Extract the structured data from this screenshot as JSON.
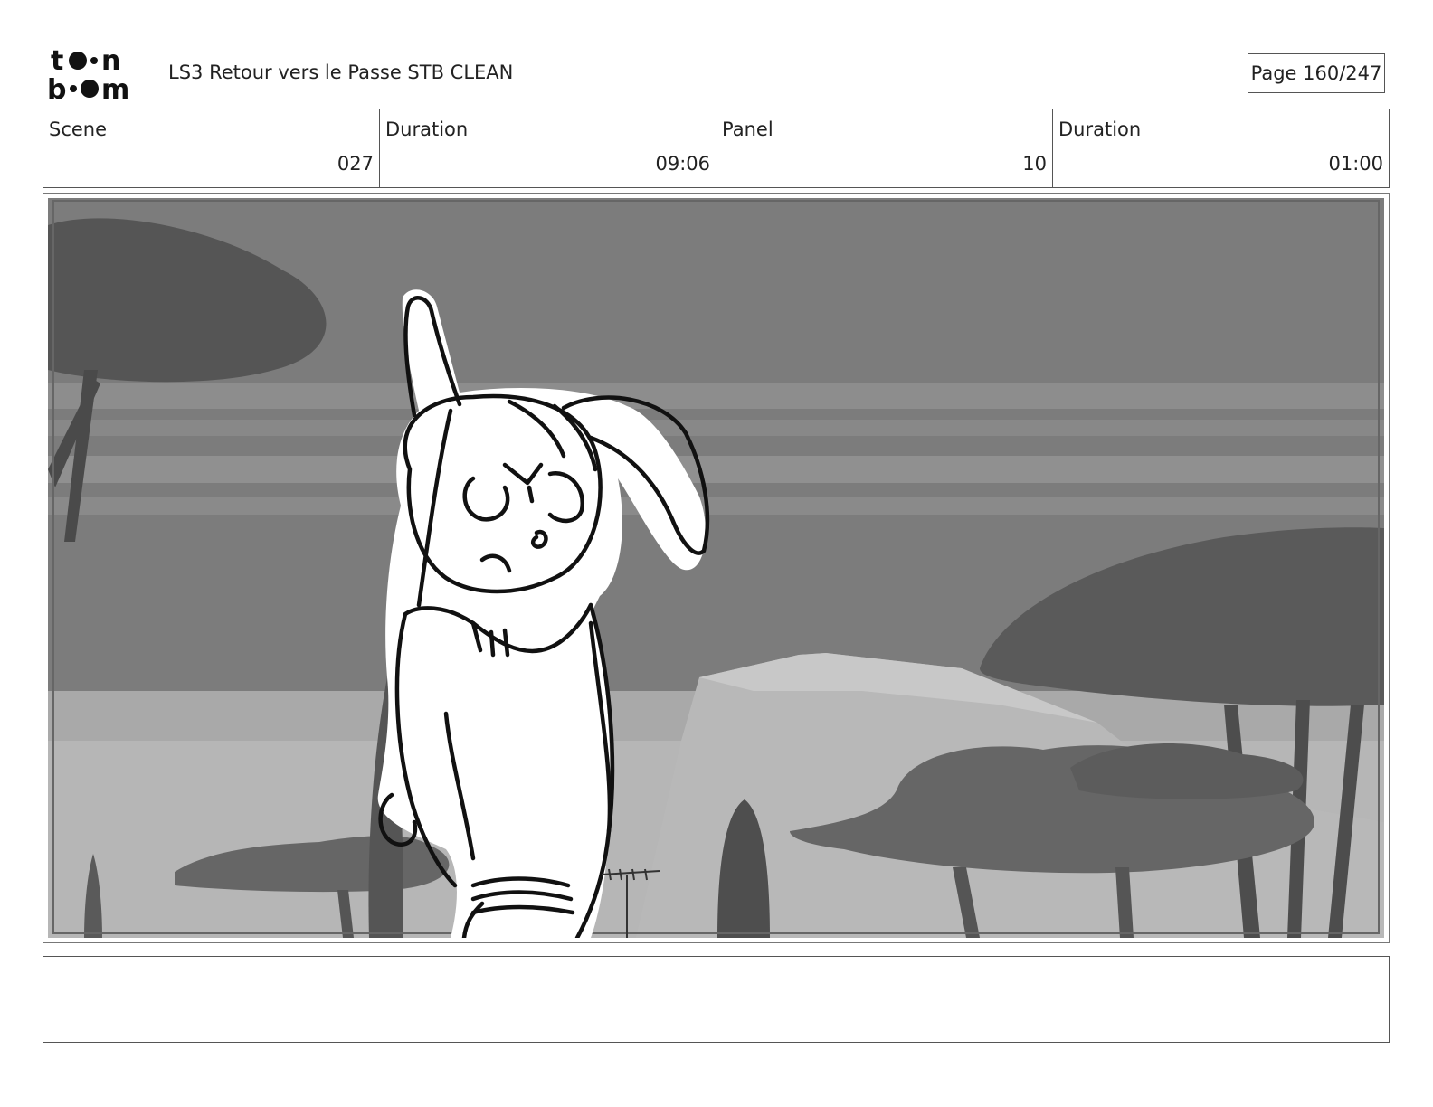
{
  "header": {
    "logo_text": "toon boom",
    "document_title": "LS3 Retour vers le Passe STB CLEAN",
    "page_label": "Page 160/247"
  },
  "info": {
    "scene_label": "Scene",
    "scene_value": "027",
    "scene_duration_label": "Duration",
    "scene_duration_value": "09:06",
    "panel_label": "Panel",
    "panel_value": "10",
    "panel_duration_label": "Duration",
    "panel_duration_value": "01:00"
  },
  "caption": {
    "text": ""
  }
}
